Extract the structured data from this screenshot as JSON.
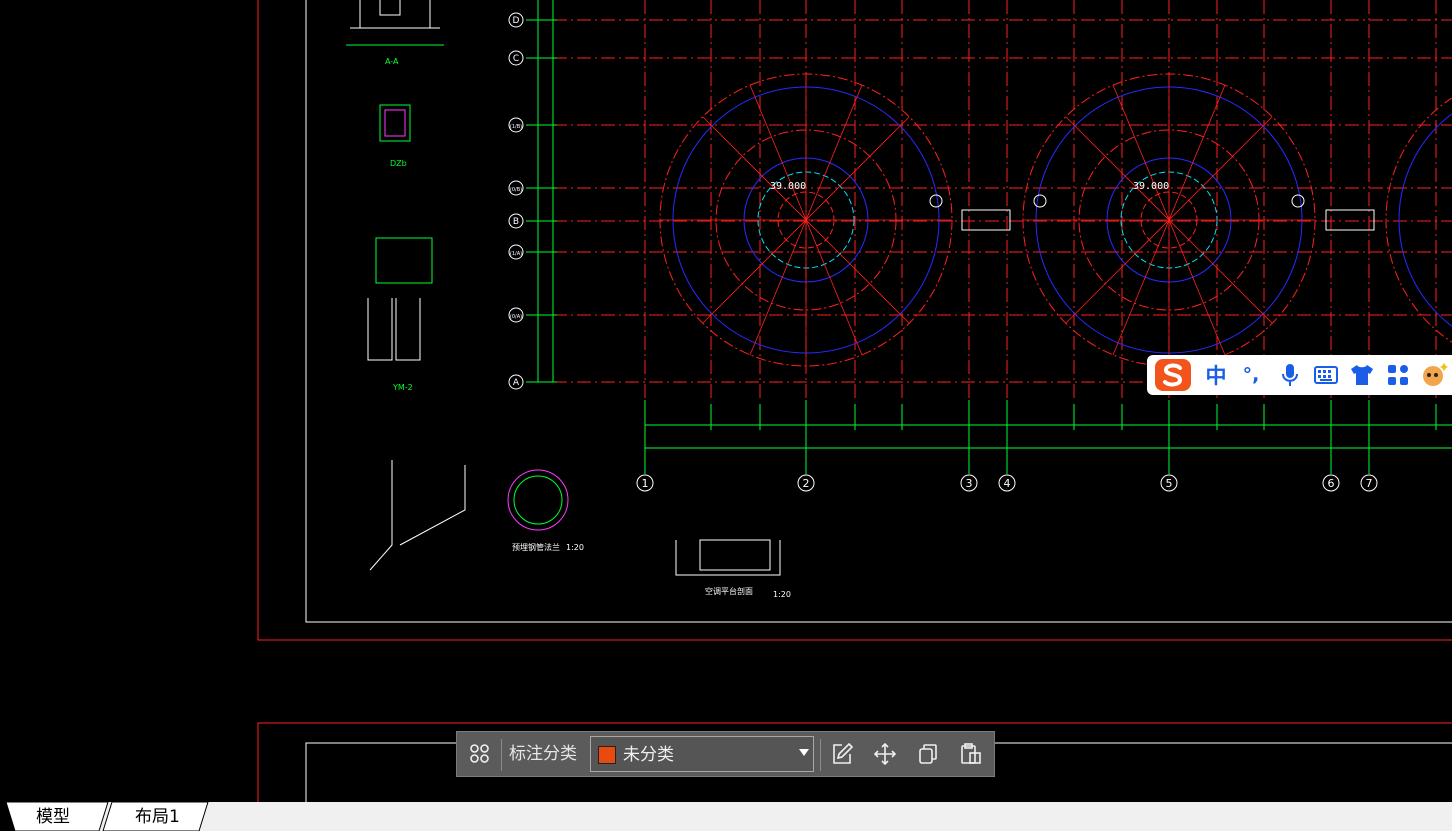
{
  "drawing": {
    "axis_rows": [
      "D",
      "C",
      "(1/B)",
      "(0/B)",
      "B",
      "(1/A)",
      "(0/A)",
      "A"
    ],
    "axis_cols": [
      "1",
      "2",
      "3",
      "4",
      "5",
      "6",
      "7"
    ],
    "elevation_labels": [
      "39.000",
      "39.000"
    ],
    "detail_labels": [
      "A-A",
      "DZb",
      "YM-2"
    ],
    "section_titles": [
      "预埋钢管法兰",
      "空调平台剖面"
    ],
    "scale_labels": [
      "1:20",
      "1:20"
    ]
  },
  "toolbar": {
    "label": "标注分类",
    "category_value": "未分类",
    "category_color": "#e84a10"
  },
  "tabs": {
    "model": "模型",
    "layout1": "布局1"
  },
  "ime": {
    "chinese_mode": "中",
    "punct": "°,"
  },
  "colors": {
    "grid": "#ff2020",
    "blue": "#2a2aff",
    "green": "#00ff33",
    "frame": "#ffffff"
  }
}
